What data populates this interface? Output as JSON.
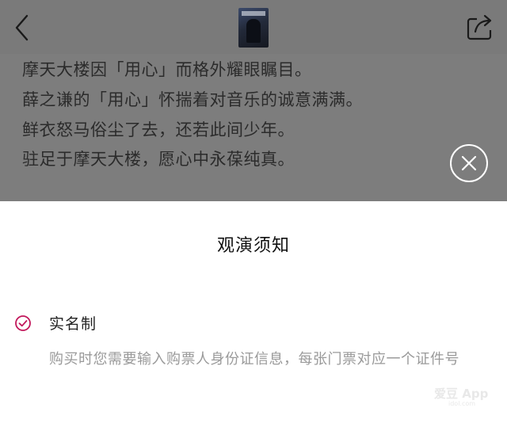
{
  "header": {
    "back_icon": "chevron-left-icon",
    "poster_alt": "show-poster-thumbnail",
    "share_icon": "share-icon"
  },
  "background": {
    "lines": [
      "摩天大楼因「用心」而格外耀眼瞩目。",
      "薛之谦的「用心」怀揣着对音乐的诚意满满。",
      "鲜衣怒马俗尘了去，还若此间少年。",
      "驻足于摩天大楼，愿心中永葆纯真。"
    ],
    "overlay_color": "#7d7d7d"
  },
  "sheet": {
    "title": "观演须知",
    "close_icon": "close-icon",
    "rules": [
      {
        "icon": "check-circle-icon",
        "title": "实名制",
        "description": "购买时您需要输入购票人身份证信息，每张门票对应一个证件号"
      }
    ]
  },
  "watermark": {
    "main": "爱豆 App",
    "sub": "idol.com"
  },
  "colors": {
    "accent": "#c2185b",
    "text_primary": "#111111",
    "text_secondary": "#9a9a9a"
  }
}
